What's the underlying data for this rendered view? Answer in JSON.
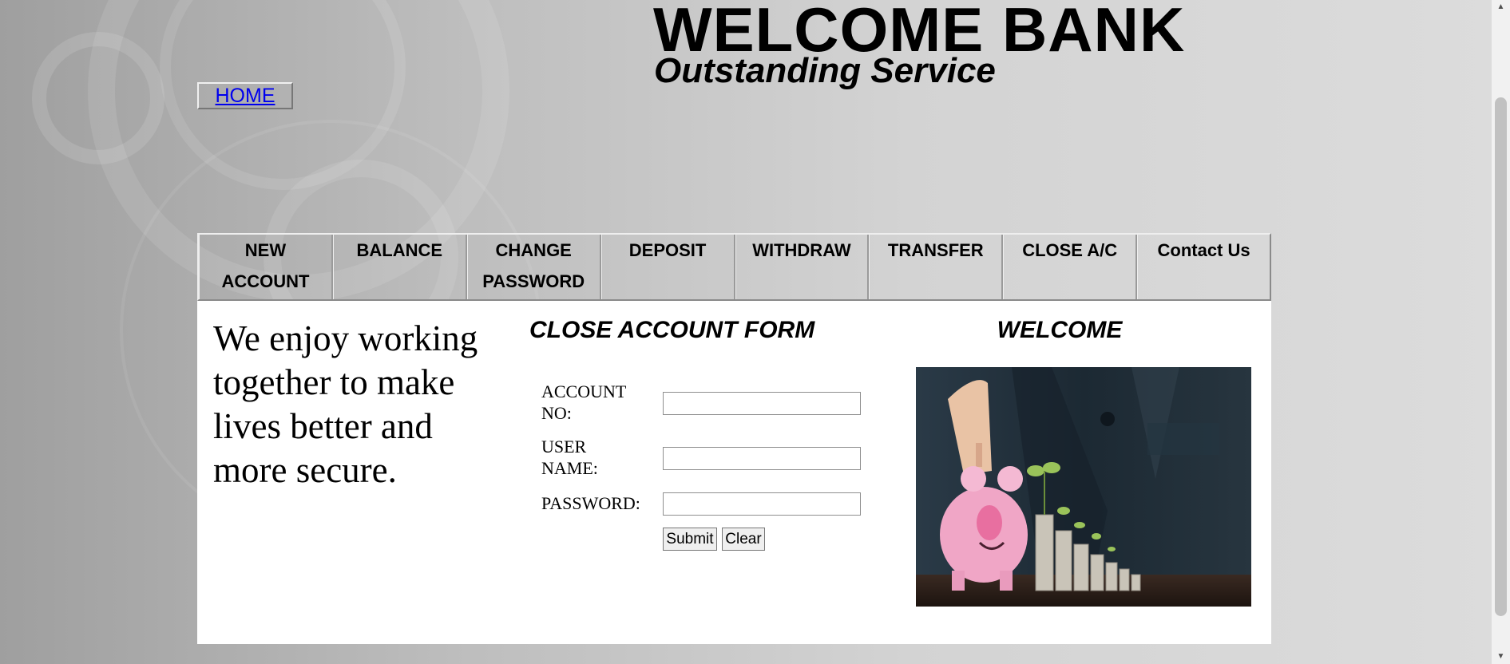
{
  "header": {
    "title": "WELCOME BANK",
    "subtitle": "Outstanding Service",
    "home_link": "HOME"
  },
  "nav": {
    "items": [
      "NEW ACCOUNT",
      "BALANCE",
      "CHANGE PASSWORD",
      "DEPOSIT",
      "WITHDRAW",
      "TRANSFER",
      "CLOSE A/C",
      "Contact Us"
    ]
  },
  "main": {
    "tagline": "We enjoy working together to make lives better and more secure."
  },
  "form": {
    "title": "CLOSE ACCOUNT FORM",
    "account_label": "ACCOUNT NO:",
    "account_value": "",
    "username_label": "USER NAME:",
    "username_value": "",
    "password_label": "PASSWORD:",
    "password_value": "",
    "submit_label": "Submit",
    "clear_label": "Clear"
  },
  "welcome": {
    "title": "WELCOME",
    "image_icon": "piggy-bank-coins-photo"
  },
  "colors": {
    "link": "#0000ee",
    "panel": "#ffffff",
    "photo_background": "#1f2c36",
    "piggy": "#f2a6c4"
  }
}
